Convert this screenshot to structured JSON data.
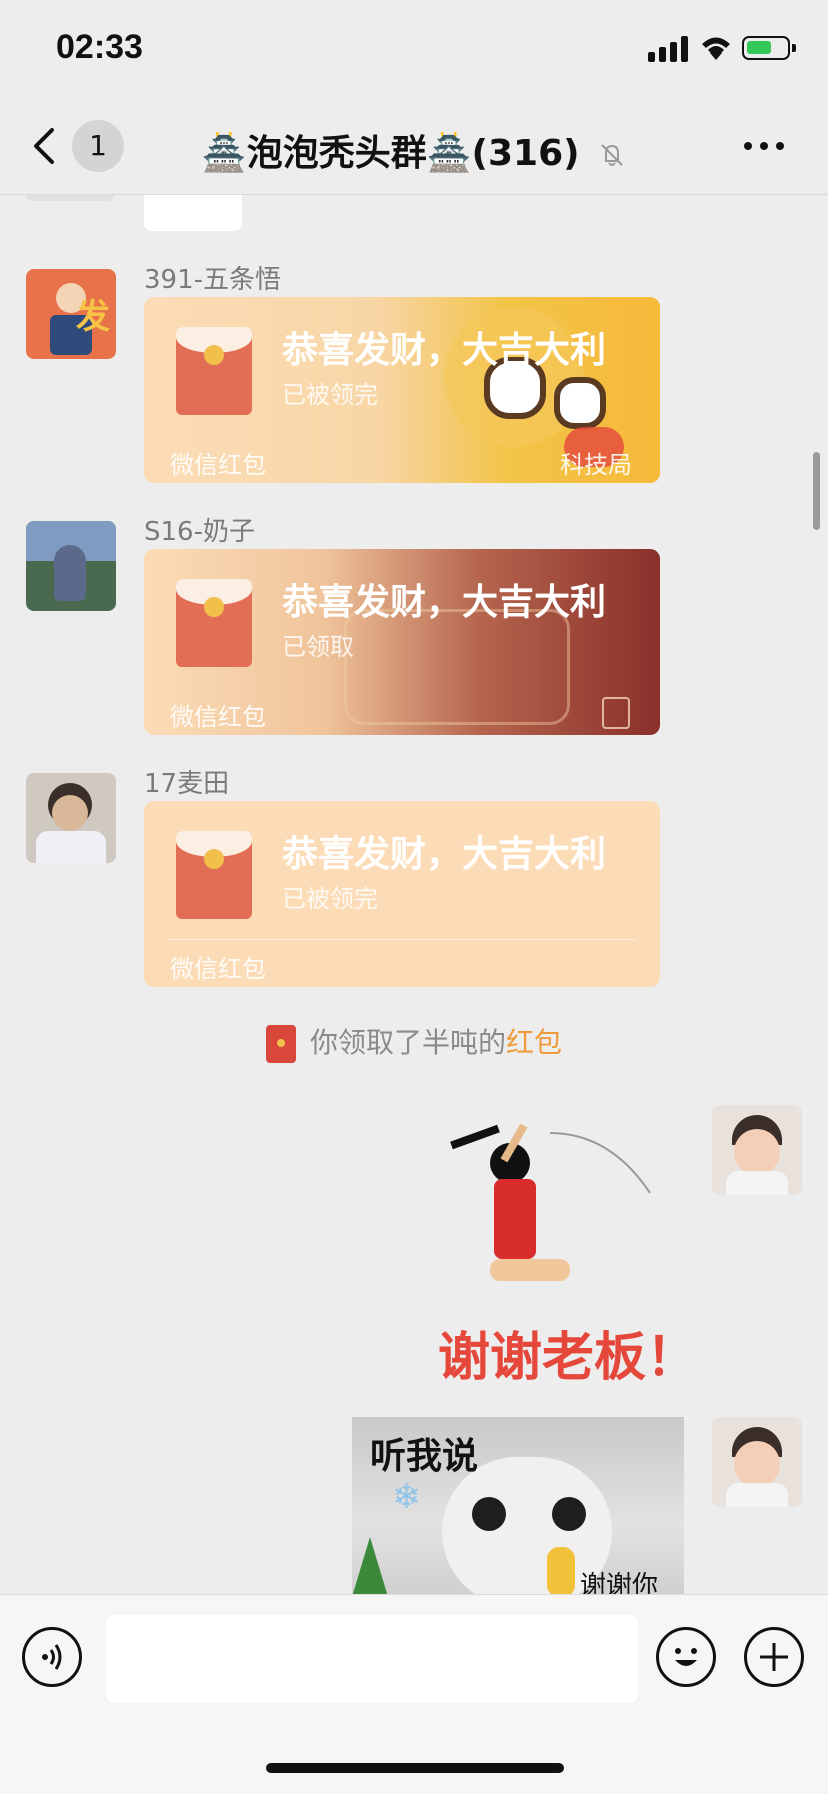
{
  "status_bar": {
    "time": "02:33"
  },
  "nav": {
    "back_label": "<",
    "unread_count": "1",
    "title": "🏯泡泡秃头群🏯(316)"
  },
  "messages": [
    {
      "sender": "391-五条悟",
      "card_title": "恭喜发财，大吉大利",
      "card_status": "已被领完",
      "card_source": "微信红包",
      "card_brand": "科技局"
    },
    {
      "sender": "S16-奶子",
      "card_title": "恭喜发财，大吉大利",
      "card_status": "已领取",
      "card_source": "微信红包"
    },
    {
      "sender": "17麦田",
      "card_title": "恭喜发财，大吉大利",
      "card_status": "已被领完",
      "card_source": "微信红包"
    }
  ],
  "system_message": {
    "text": "你领取了半吨的",
    "link": "红包"
  },
  "stickers": {
    "thank_boss": "谢谢老板！",
    "image_caption": "听我说",
    "image_caption_bottom": "谢谢你"
  },
  "input": {
    "placeholder": ""
  },
  "colors": {
    "accent": "#f09b3b",
    "red_packet": "#e26e55",
    "card_bg": "#fbdcb7"
  }
}
